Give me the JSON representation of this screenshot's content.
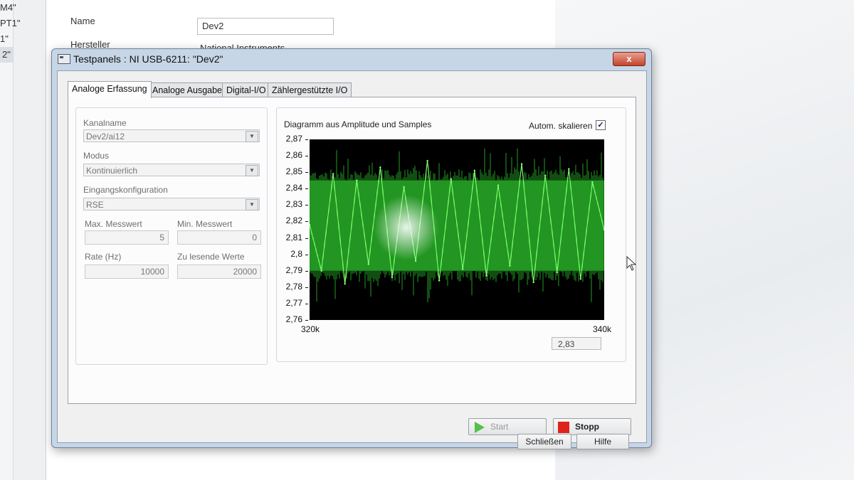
{
  "background_app": {
    "tree_items": [
      "M4\"",
      "PT1\"",
      "1\"",
      "2\""
    ],
    "name_label": "Name",
    "name_value": "Dev2",
    "manufacturer_label": "Hersteller",
    "manufacturer_value": "National Instruments"
  },
  "dialog": {
    "title": "Testpanels : NI USB-6211: \"Dev2\"",
    "close_symbol": "x",
    "tabs": [
      {
        "label": "Analoge Erfassung",
        "active": true
      },
      {
        "label": "Analoge Ausgabe",
        "active": false
      },
      {
        "label": "Digital-I/O",
        "active": false
      },
      {
        "label": "Zählergestützte I/O",
        "active": false
      }
    ],
    "channel": {
      "label": "Kanalname",
      "value": "Dev2/ai12"
    },
    "mode": {
      "label": "Modus",
      "value": "Kontinuierlich"
    },
    "input_config": {
      "label": "Eingangskonfiguration",
      "value": "RSE"
    },
    "max_value": {
      "label": "Max. Messwert",
      "value": "5"
    },
    "min_value": {
      "label": "Min. Messwert",
      "value": "0"
    },
    "rate": {
      "label": "Rate (Hz)",
      "value": "10000"
    },
    "samples": {
      "label": "Zu lesende Werte",
      "value": "20000"
    },
    "chart_title": "Diagramm aus Amplitude und Samples",
    "autoscale_label": "Autom. skalieren",
    "autoscale_checked": true,
    "readout_value": "2,83",
    "start_label": "Start",
    "stop_label": "Stopp",
    "close_label": "Schließen",
    "help_label": "Hilfe"
  },
  "chart_data": {
    "type": "line",
    "title": "Diagramm aus Amplitude und Samples",
    "xlabel": "",
    "ylabel": "",
    "xlim": [
      320000,
      340000
    ],
    "ylim": [
      2.76,
      2.87
    ],
    "x_tick_labels": [
      "320k",
      "340k"
    ],
    "y_tick_labels": [
      "2,87",
      "2,86",
      "2,85",
      "2,84",
      "2,83",
      "2,82",
      "2,81",
      "2,8",
      "2,79",
      "2,78",
      "2,77",
      "2,76"
    ],
    "grid": false,
    "series_color": "#2fd02f",
    "plot_background": "#000000",
    "series": [
      {
        "name": "",
        "x": [
          320000,
          320800,
          321600,
          322400,
          323200,
          324000,
          324800,
          325600,
          326400,
          327200,
          328000,
          328800,
          329600,
          330400,
          331200,
          332000,
          332800,
          333600,
          334400,
          335200,
          336000,
          336800,
          337600,
          338400,
          339200,
          340000
        ],
        "y": [
          2.818,
          2.79,
          2.849,
          2.782,
          2.845,
          2.794,
          2.853,
          2.786,
          2.841,
          2.796,
          2.857,
          2.784,
          2.846,
          2.791,
          2.851,
          2.787,
          2.842,
          2.793,
          2.855,
          2.783,
          2.848,
          2.789,
          2.852,
          2.785,
          2.844,
          2.815
        ]
      }
    ]
  }
}
